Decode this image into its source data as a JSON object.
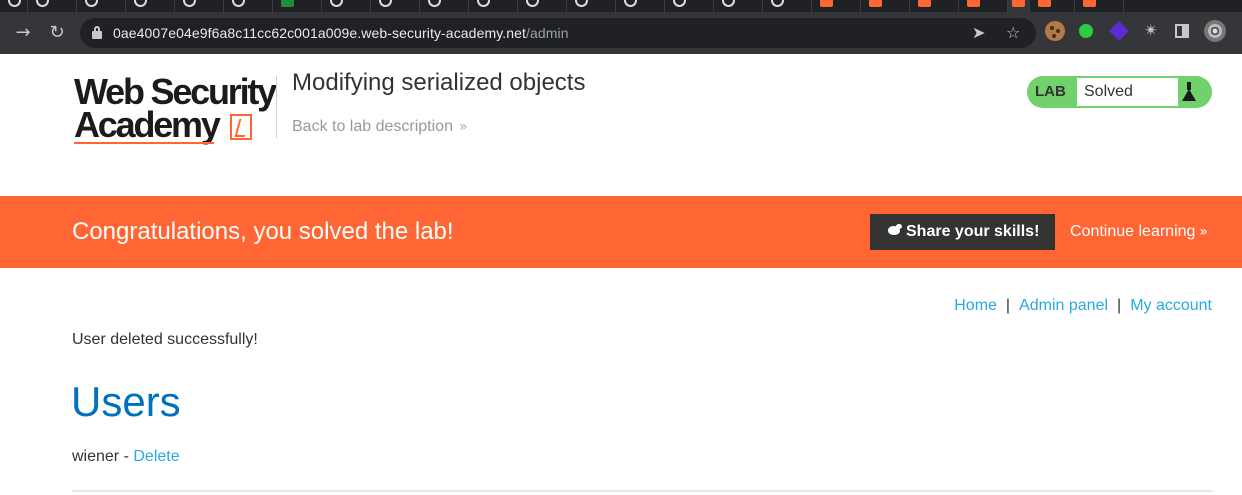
{
  "browser": {
    "url_host": "0ae4007e04e9f6a8c11cc62c001a009e.web-security-academy.net",
    "url_path": "/admin",
    "icons": [
      "back-arrow-icon",
      "forward-arrow-icon",
      "reload-icon",
      "lock-icon",
      "send-icon",
      "star-icon",
      "cookie-extension-icon",
      "green-extension-icon",
      "purple-extension-icon",
      "puzzle-extension-icon",
      "side-panel-icon",
      "profile-avatar-icon"
    ]
  },
  "header": {
    "logo_line1": "Web Security",
    "logo_line2": "Academy",
    "lab_title": "Modifying serialized objects",
    "back_link": "Back to lab description",
    "lab_badge_label": "LAB",
    "lab_status": "Solved",
    "colors": {
      "brand": "#ff6633",
      "solved_green": "#70d16d"
    }
  },
  "banner": {
    "message": "Congratulations, you solved the lab!",
    "share_button": "Share your skills!",
    "continue_link": "Continue learning"
  },
  "nav": {
    "home": "Home",
    "separator": "|",
    "admin_panel": "Admin panel",
    "my_account": "My account"
  },
  "main": {
    "notice": "User deleted successfully!",
    "heading": "Users",
    "users": [
      {
        "name": "wiener",
        "separator": " - ",
        "action": "Delete"
      }
    ],
    "colors": {
      "link": "#29a9e0",
      "heading": "#0071bc"
    }
  }
}
